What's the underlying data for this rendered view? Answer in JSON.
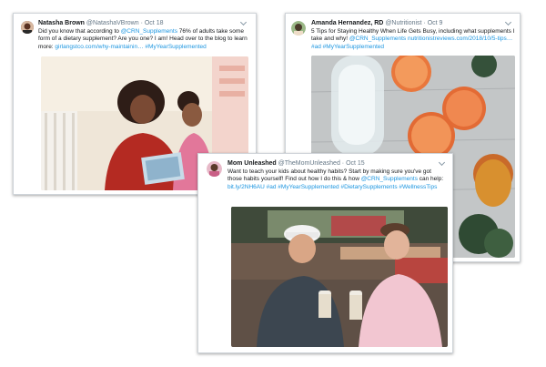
{
  "tweets": [
    {
      "author": "Natasha Brown",
      "handle": "@NatashaVBrown",
      "date": "· Oct 18",
      "text_1": "Did you know that according to ",
      "mention": "@CRN_Supplements",
      "text_2": " 76% of adults take some form of a dietary supplement? Are you one? I am! Head over to the blog to learn more: ",
      "link": "girlangstco.com/why-maintainin…",
      "hashtag": "#MyYearSupplemented"
    },
    {
      "author": "Amanda Hernandez, RD",
      "handle": "@Nutritionist",
      "date": "· Oct 9",
      "text_1": "5 Tips for Staying Healthy When Life Gets Busy, including what supplements I take and why! ",
      "mention": "@CRN_Supplements",
      "text_2": " ",
      "link": "nutritionistreviews.com/2018/10/5-tips…",
      "text_3": " #ad",
      "hashtag": "#MyYearSupplemented"
    },
    {
      "author": "Mom Unleashed",
      "handle": "@TheMomUnleashed",
      "date": "· Oct 15",
      "text_1": "Want to teach your kids about healthy habits? Start by making sure you've got those habits yourself! Find out how I do this & how ",
      "mention": "@CRN_Supplements",
      "text_2": " can help: ",
      "link": "bit.ly/2NH6AU",
      "text_3": " #ad ",
      "hashtag": "#MyYearSupplemented",
      "hashtag_2": "#DietarySupplements",
      "hashtag_3": "#WellnessTips"
    }
  ],
  "colors": {
    "link": "#1b95e0",
    "name": "#14171a",
    "handle": "#657786",
    "border": "#cfd4d9"
  }
}
